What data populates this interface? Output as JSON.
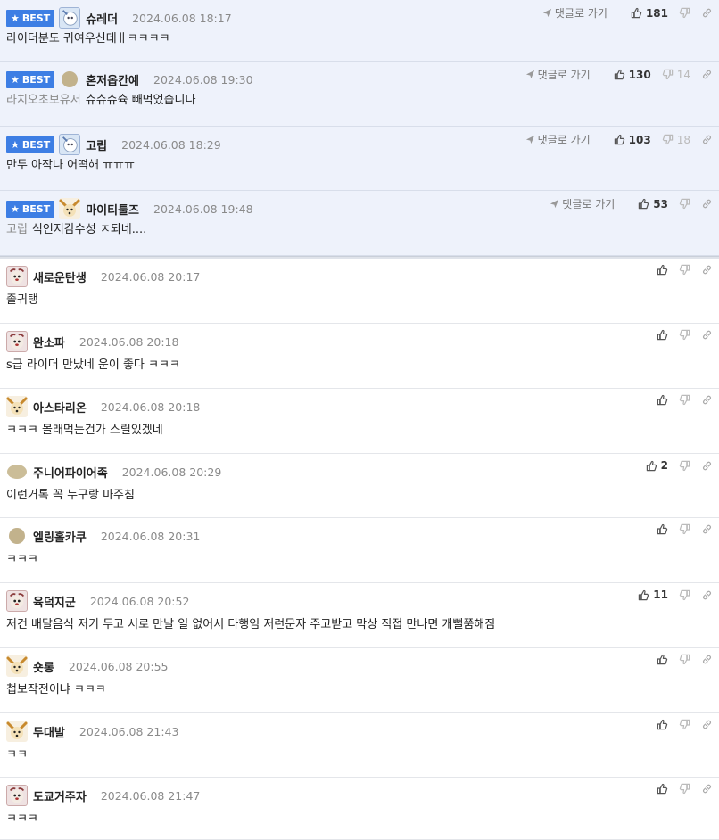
{
  "labels": {
    "best": "BEST",
    "goto": "댓글로 가기"
  },
  "best_comments": [
    {
      "nick": "슈레더",
      "date": "2024.06.08 18:17",
      "reply_to": "",
      "text": "라이더분도 귀여우신데ㅐㅋㅋㅋㅋ",
      "likes": "181",
      "dislikes": "",
      "avatar": "sq",
      "top": 0,
      "h": 69
    },
    {
      "nick": "혼저옵칸예",
      "date": "2024.06.08 19:30",
      "reply_to": "라치오초보유저",
      "text": "슈슈슈슉 빼먹었습니다",
      "likes": "130",
      "dislikes": "14",
      "avatar": "dot"
    },
    {
      "nick": "고립",
      "date": "2024.06.08 18:29",
      "reply_to": "",
      "text": "만두 아작나 어떡해 ㅠㅠㅠ",
      "likes": "103",
      "dislikes": "18",
      "avatar": "sq"
    },
    {
      "nick": "마이티툴즈",
      "date": "2024.06.08 19:48",
      "reply_to": "고립",
      "text": "식인지감수성 ㅈ되네....",
      "likes": "53",
      "dislikes": "",
      "avatar": "dog"
    }
  ],
  "comments": [
    {
      "nick": "새로운탄생",
      "date": "2024.06.08 20:17",
      "text": "졸귀탱",
      "likes": "",
      "avatar": "red"
    },
    {
      "nick": "완소파",
      "date": "2024.06.08 20:18",
      "text": "s급 라이더 만났네 운이 좋다 ㅋㅋㅋ",
      "likes": "",
      "avatar": "red"
    },
    {
      "nick": "아스타리온",
      "date": "2024.06.08 20:18",
      "text": "ㅋㅋㅋ 몰래먹는건가 스릴있겠네",
      "likes": "",
      "avatar": "dog"
    },
    {
      "nick": "주니어파이어족",
      "date": "2024.06.08 20:29",
      "text": "이런거톡 꼭 누구랑 마주침",
      "likes": "2",
      "avatar": "dot2"
    },
    {
      "nick": "엘링홀카쿠",
      "date": "2024.06.08 20:31",
      "text": "ㅋㅋㅋ",
      "likes": "",
      "avatar": "dot"
    },
    {
      "nick": "육덕지군",
      "date": "2024.06.08 20:52",
      "text": "저건 배달음식 저기 두고 서로 만날 일 없어서 다행임 저런문자 주고받고 막상 직접 만나면 개뻘쭘해짐",
      "likes": "11",
      "avatar": "red"
    },
    {
      "nick": "숏롱",
      "date": "2024.06.08 20:55",
      "text": "첩보작전이냐 ㅋㅋㅋ",
      "likes": "",
      "avatar": "dog"
    },
    {
      "nick": "두대발",
      "date": "2024.06.08 21:43",
      "text": "ㅋㅋ",
      "likes": "",
      "avatar": "dog"
    },
    {
      "nick": "도쿄거주자",
      "date": "2024.06.08 21:47",
      "text": "ㅋㅋㅋ",
      "likes": "",
      "avatar": "red"
    }
  ]
}
